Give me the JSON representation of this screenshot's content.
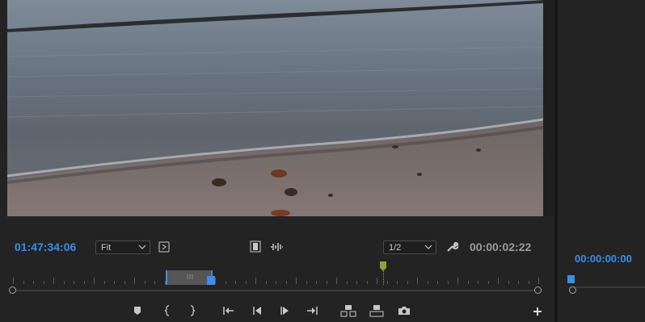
{
  "source_monitor": {
    "timecode_current": "01:47:34:06",
    "zoom_select": "Fit",
    "resolution_select": "1/2",
    "duration_timecode": "00:00:02:22",
    "colors": {
      "timecode": "#3a8ee6",
      "playhead": "#3a8ee6",
      "marker": "#8aa33a"
    },
    "icons": {
      "settings": "wrench-icon",
      "safe_margins": "bracket-square-icon",
      "drag_video": "film-icon",
      "drag_audio": "waveform-icon"
    },
    "transport": [
      {
        "name": "add-marker-button",
        "icon": "marker-icon"
      },
      {
        "name": "mark-in-button",
        "icon": "mark-in-icon"
      },
      {
        "name": "mark-out-button",
        "icon": "mark-out-icon"
      },
      {
        "name": "go-to-in-button",
        "icon": "go-to-in-icon"
      },
      {
        "name": "step-back-button",
        "icon": "step-back-icon"
      },
      {
        "name": "play-button",
        "icon": "play-icon"
      },
      {
        "name": "go-to-out-button",
        "icon": "go-to-out-icon"
      },
      {
        "name": "insert-button",
        "icon": "insert-icon"
      },
      {
        "name": "overwrite-button",
        "icon": "overwrite-icon"
      },
      {
        "name": "export-frame-button",
        "icon": "camera-icon"
      }
    ],
    "add_button_icon": "plus-icon"
  },
  "program_monitor": {
    "timecode_current": "00:00:00:00"
  }
}
